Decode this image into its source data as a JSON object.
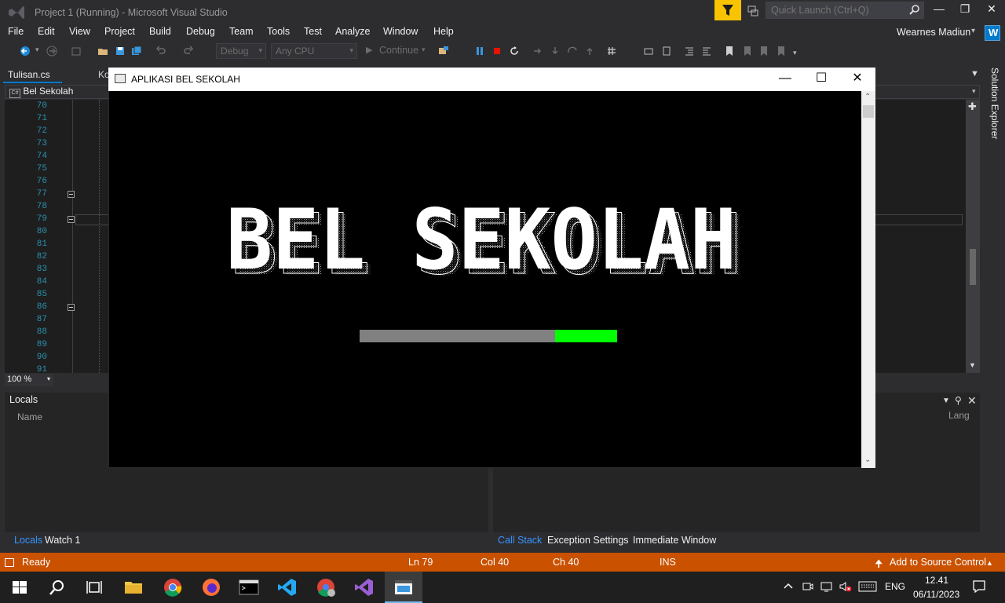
{
  "window_title": "Project 1 (Running) - Microsoft Visual Studio",
  "quick_launch_placeholder": "Quick Launch (Ctrl+Q)",
  "user_name": "Wearnes Madiun",
  "user_badge": "W",
  "menu": [
    "File",
    "Edit",
    "View",
    "Project",
    "Build",
    "Debug",
    "Team",
    "Tools",
    "Test",
    "Analyze",
    "Window",
    "Help"
  ],
  "toolbar": {
    "configuration": "Debug",
    "platform": "Any CPU",
    "continue_label": "Continue"
  },
  "tabs": {
    "active": "Tulisan.cs",
    "second": "Ko"
  },
  "navigation": {
    "project": "Bel Sekolah"
  },
  "editor": {
    "line_numbers": [
      "70",
      "71",
      "72",
      "73",
      "74",
      "75",
      "76",
      "77",
      "78",
      "79",
      "80",
      "81",
      "82",
      "83",
      "84",
      "85",
      "86",
      "87",
      "88",
      "89",
      "90",
      "91"
    ],
    "zoom": "100 %"
  },
  "solution_explorer_label": "Solution Explorer",
  "locals": {
    "title": "Locals",
    "column_name": "Name",
    "column_lang": "Lang"
  },
  "bottom_tabs_left": [
    "Locals",
    "Watch 1"
  ],
  "bottom_tabs_right": [
    "Call Stack",
    "Exception Settings",
    "Immediate Window"
  ],
  "status": {
    "state": "Ready",
    "line": "Ln 79",
    "col": "Col 40",
    "ch": "Ch 40",
    "mode": "INS",
    "source_control": "Add to Source Control"
  },
  "taskbar": {
    "language": "ENG",
    "time": "12.41",
    "date": "06/11/2023"
  },
  "console": {
    "title": "APLIKASI BEL SEKOLAH",
    "banner_text": "BEL SEKOLAH",
    "progress_fraction": 0.24,
    "progress_color": "#00ff00",
    "track_color": "#808080"
  },
  "colors": {
    "statusbar": "#ca5100",
    "accent": "#007acc",
    "feedback": "#f8c300"
  }
}
